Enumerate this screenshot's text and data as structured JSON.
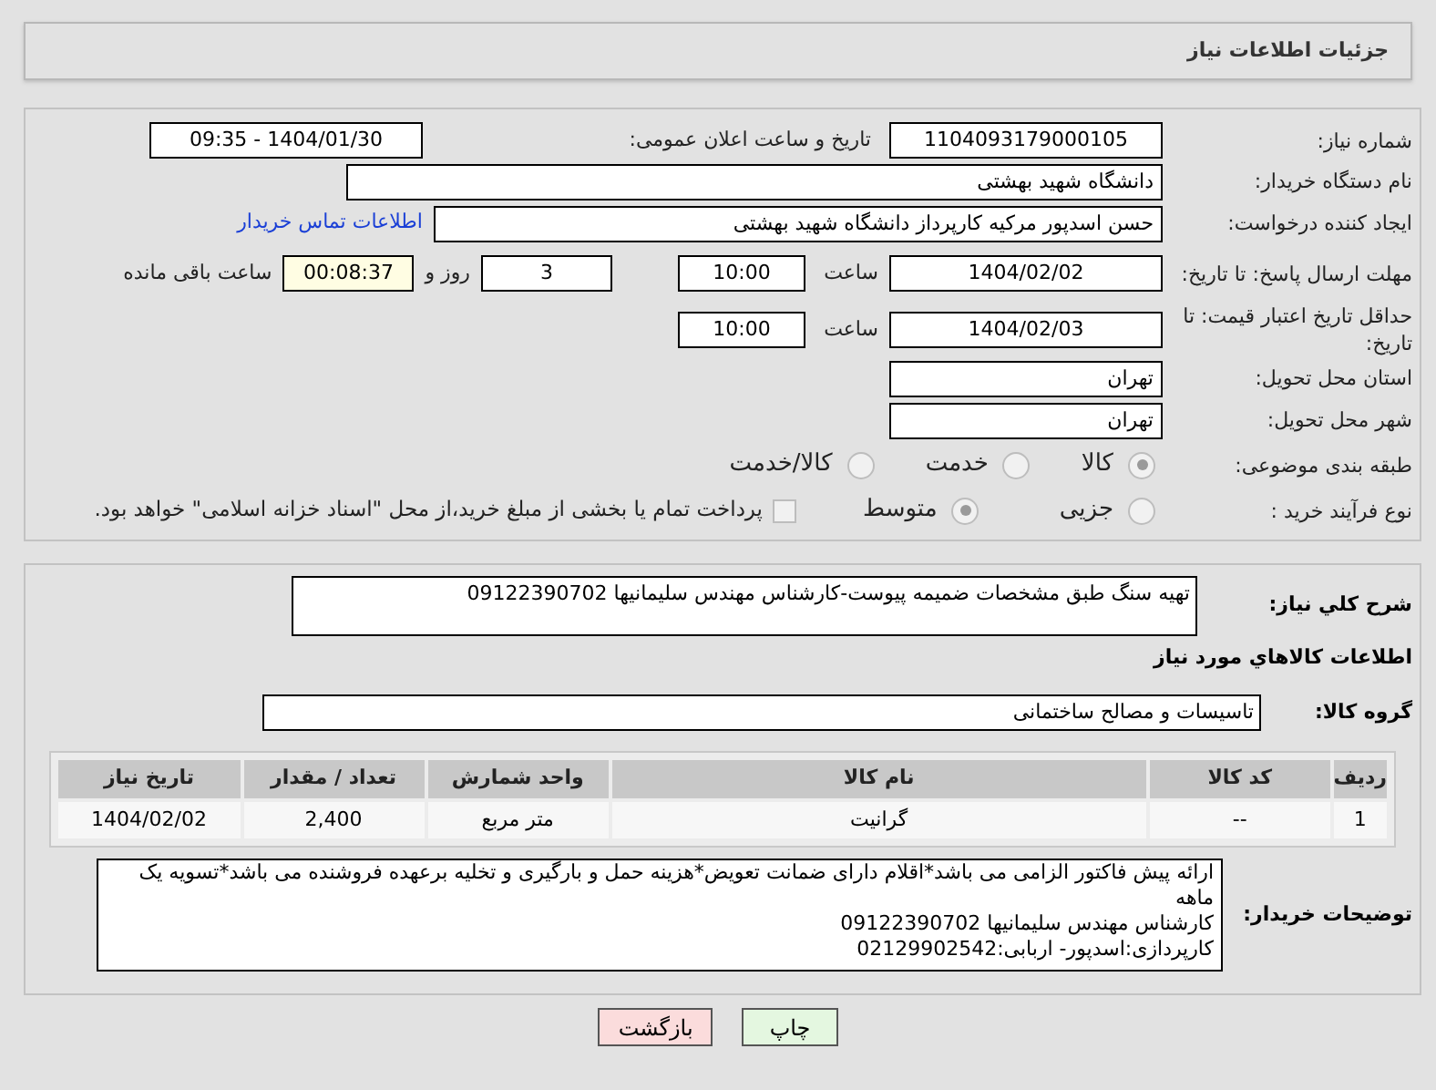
{
  "header": {
    "title": "جزئیات اطلاعات نیاز"
  },
  "need_number": {
    "label": "شماره نیاز:",
    "value": "1104093179000105"
  },
  "announce_date": {
    "label": "تاریخ و ساعت اعلان عمومی:",
    "value": "1404/01/30 - 09:35"
  },
  "buyer_org": {
    "label": "نام دستگاه خریدار:",
    "value": "دانشگاه شهید بهشتی"
  },
  "requester": {
    "label": "ایجاد کننده درخواست:",
    "value": "حسن اسدپور مرکیه کارپرداز دانشگاه شهید بهشتی",
    "link": "اطلاعات تماس خریدار"
  },
  "reply_deadline": {
    "label": "مهلت ارسال پاسخ: تا تاریخ:",
    "date": "1404/02/02",
    "time_label": "ساعت",
    "time": "10:00",
    "days": "3",
    "days_label": "روز و",
    "remaining": "00:08:37",
    "remaining_label": "ساعت باقی مانده"
  },
  "price_validity": {
    "label": "حداقل تاریخ اعتبار قیمت: تا تاریخ:",
    "date": "1404/02/03",
    "time_label": "ساعت",
    "time": "10:00"
  },
  "province": {
    "label": "استان محل تحویل:",
    "value": "تهران"
  },
  "city": {
    "label": "شهر محل تحویل:",
    "value": "تهران"
  },
  "category": {
    "label": "طبقه بندی موضوعی:",
    "options": [
      {
        "label": "کالا",
        "selected": true
      },
      {
        "label": "خدمت",
        "selected": false
      },
      {
        "label": "کالا/خدمت",
        "selected": false
      }
    ]
  },
  "process": {
    "label": "نوع فرآیند خرید :",
    "options": [
      {
        "label": "جزیی",
        "selected": false
      },
      {
        "label": "متوسط",
        "selected": true
      }
    ],
    "treasury": {
      "label": "پرداخت تمام یا بخشی از مبلغ خرید،از محل \"اسناد خزانه اسلامی\" خواهد بود.",
      "checked": false
    }
  },
  "description": {
    "label": "شرح کلي نياز:",
    "value": "تهیه سنگ طبق مشخصات ضمیمه پیوست-کارشناس مهندس سلیمانیها 09122390702"
  },
  "goods_heading": "اطلاعات کالاهاي مورد نياز",
  "goods_group": {
    "label": "گروه کالا:",
    "value": "تاسیسات و مصالح ساختمانی"
  },
  "table": {
    "columns": [
      "ردیف",
      "کد کالا",
      "نام کالا",
      "واحد شمارش",
      "تعداد / مقدار",
      "تاریخ نیاز"
    ],
    "rows": [
      [
        "1",
        "--",
        "گرانیت",
        "متر مربع",
        "2,400",
        "1404/02/02"
      ]
    ]
  },
  "buyer_notes": {
    "label": "توضیحات خریدار:",
    "lines": [
      "ارائه پیش فاکتور الزامی می باشد*اقلام دارای ضمانت تعویض*هزینه حمل و بارگیری و تخلیه برعهده فروشنده می باشد*تسویه یک ماهه",
      "کارشناس مهندس سلیمانیها 09122390702",
      "کارپردازی:اسدپور- اربابی:02129902542"
    ]
  },
  "buttons": [
    {
      "label": "چاپ",
      "kind": "print"
    },
    {
      "label": "بازگشت",
      "kind": "back"
    }
  ]
}
